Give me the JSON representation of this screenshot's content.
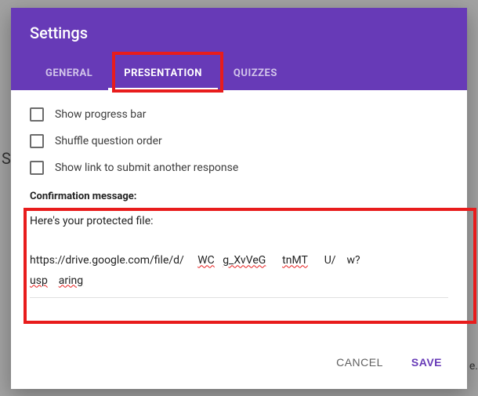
{
  "dialog": {
    "title": "Settings",
    "tabs": [
      {
        "label": "GENERAL",
        "active": false
      },
      {
        "label": "PRESENTATION",
        "active": true
      },
      {
        "label": "QUIZZES",
        "active": false
      }
    ]
  },
  "presentation": {
    "options": [
      {
        "label": "Show progress bar",
        "checked": false
      },
      {
        "label": "Shuffle question order",
        "checked": false
      },
      {
        "label": "Show link to submit another response",
        "checked": false
      }
    ],
    "confirmation_label": "Confirmation message:",
    "confirmation_intro": "Here's your protected file:",
    "confirmation_url_parts": {
      "p1": "https://drive.google.com/file/d/",
      "p2": "WC",
      "p3": "g_XvVeG",
      "p4": "tnMT",
      "p5": "U/",
      "p6": "w?",
      "p7": "usp",
      "p8": "aring"
    }
  },
  "actions": {
    "cancel": "CANCEL",
    "save": "SAVE"
  },
  "background_hints": {
    "s": "S",
    "e": "e."
  }
}
